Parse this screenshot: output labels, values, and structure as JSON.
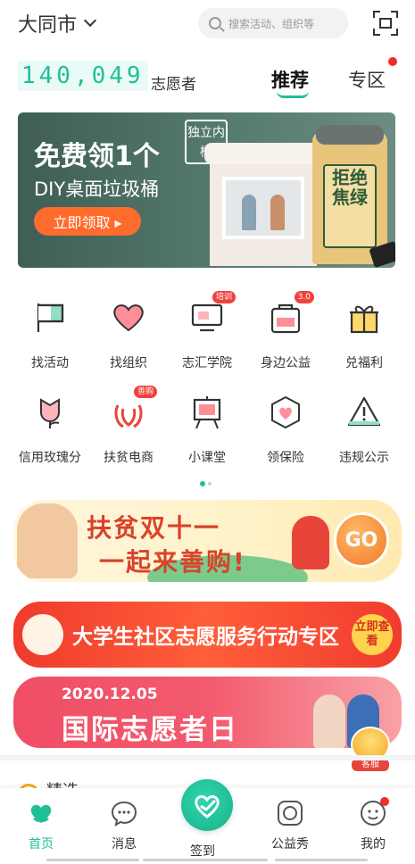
{
  "header": {
    "city": "大同市",
    "search_placeholder": "搜索活动、组织等"
  },
  "stats": {
    "volunteer_count": "140,049",
    "volunteer_label": "志愿者"
  },
  "tabs": [
    {
      "label": "推荐",
      "active": true
    },
    {
      "label": "专区",
      "active": false,
      "has_dot": true
    }
  ],
  "banner": {
    "title": "免费领1个",
    "subtitle": "DIY桌面垃圾桶",
    "button": "立即领取 ▸",
    "tag": "独立内桶",
    "product_text": "拒绝焦绿",
    "pages": 4,
    "active_page": 1
  },
  "grid": [
    {
      "label": "找活动",
      "icon": "flag-icon"
    },
    {
      "label": "找组织",
      "icon": "heart-icon"
    },
    {
      "label": "志汇学院",
      "icon": "monitor-icon",
      "badge": "培训"
    },
    {
      "label": "身边公益",
      "icon": "bag-icon",
      "badge": "3.0"
    },
    {
      "label": "兑福利",
      "icon": "gift-icon"
    },
    {
      "label": "信用玫瑰分",
      "icon": "rose-icon"
    },
    {
      "label": "扶贫电商",
      "icon": "shopping-bag-icon",
      "badge": "善购"
    },
    {
      "label": "小课堂",
      "icon": "easel-icon"
    },
    {
      "label": "领保险",
      "icon": "shield-heart-icon"
    },
    {
      "label": "违规公示",
      "icon": "warning-icon"
    }
  ],
  "promos": {
    "p1_line1": "扶贫双十一",
    "p1_line2": "一起来善购!",
    "p1_go": "GO",
    "p2_title": "大学生社区志愿服务行动专区",
    "p2_view": "立即查看",
    "p3_date": "2020.12.05",
    "p3_title": "国际志愿者日",
    "service": "客服"
  },
  "section": {
    "title": "精选"
  },
  "nav": [
    {
      "label": "首页",
      "icon": "home-heart-icon",
      "active": true
    },
    {
      "label": "消息",
      "icon": "chat-icon"
    },
    {
      "label": "签到",
      "icon": "checkin-heart-icon"
    },
    {
      "label": "公益秀",
      "icon": "camera-icon"
    },
    {
      "label": "我的",
      "icon": "profile-icon",
      "has_dot": true
    }
  ],
  "colors": {
    "accent": "#1fbf9a",
    "alert": "#f02c2c",
    "promo_red": "#ef3b2d"
  }
}
